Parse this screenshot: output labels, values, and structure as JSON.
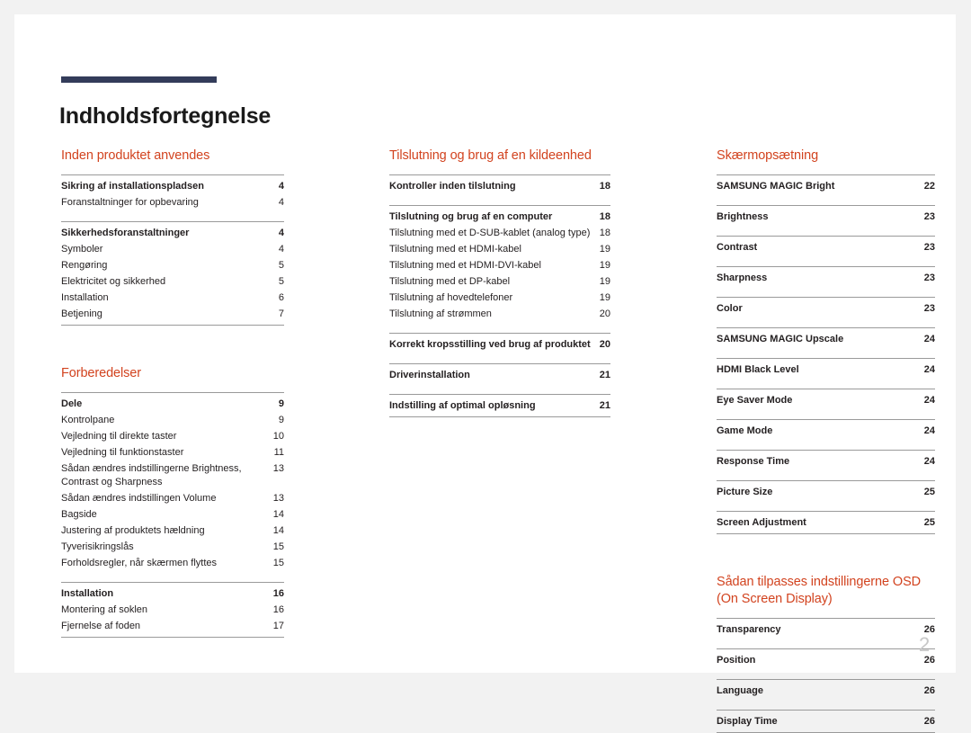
{
  "document": {
    "title": "Indholdsfortegnelse",
    "page_number": "2",
    "accent_color": "#d2431f",
    "rule_color": "#333c5a"
  },
  "columns": [
    {
      "name": "column-left",
      "sections": [
        {
          "heading": "Inden produktet anvendes",
          "blocks": [
            {
              "entries": [
                {
                  "label": "Sikring af installationspladsen",
                  "page": "4",
                  "level": "main"
                },
                {
                  "label": "Foranstaltninger for opbevaring",
                  "page": "4",
                  "level": "sub"
                }
              ]
            },
            {
              "entries": [
                {
                  "label": "Sikkerhedsforanstaltninger",
                  "page": "4",
                  "level": "main"
                },
                {
                  "label": "Symboler",
                  "page": "4",
                  "level": "sub"
                },
                {
                  "label": "Rengøring",
                  "page": "5",
                  "level": "sub"
                },
                {
                  "label": "Elektricitet og sikkerhed",
                  "page": "5",
                  "level": "sub"
                },
                {
                  "label": "Installation",
                  "page": "6",
                  "level": "sub"
                },
                {
                  "label": "Betjening",
                  "page": "7",
                  "level": "sub"
                }
              ]
            }
          ]
        },
        {
          "heading": "Forberedelser",
          "blocks": [
            {
              "entries": [
                {
                  "label": "Dele",
                  "page": "9",
                  "level": "main"
                },
                {
                  "label": "Kontrolpane",
                  "page": "9",
                  "level": "sub"
                },
                {
                  "label": "Vejledning til direkte taster",
                  "page": "10",
                  "level": "sub"
                },
                {
                  "label": "Vejledning til funktionstaster",
                  "page": "11",
                  "level": "sub"
                },
                {
                  "label": "Sådan ændres indstillingerne Brightness, Contrast og Sharpness",
                  "page": "13",
                  "level": "sub"
                },
                {
                  "label": "Sådan ændres indstillingen Volume",
                  "page": "13",
                  "level": "sub"
                },
                {
                  "label": "Bagside",
                  "page": "14",
                  "level": "sub"
                },
                {
                  "label": "Justering af produktets hældning",
                  "page": "14",
                  "level": "sub"
                },
                {
                  "label": "Tyverisikringslås",
                  "page": "15",
                  "level": "sub"
                },
                {
                  "label": "Forholdsregler, når skærmen flyttes",
                  "page": "15",
                  "level": "sub"
                }
              ]
            },
            {
              "entries": [
                {
                  "label": "Installation",
                  "page": "16",
                  "level": "main"
                },
                {
                  "label": "Montering af soklen",
                  "page": "16",
                  "level": "sub"
                },
                {
                  "label": "Fjernelse af foden",
                  "page": "17",
                  "level": "sub"
                }
              ]
            }
          ]
        }
      ]
    },
    {
      "name": "column-middle",
      "sections": [
        {
          "heading": "Tilslutning og brug af en kildeenhed",
          "blocks": [
            {
              "entries": [
                {
                  "label": "Kontroller inden tilslutning",
                  "page": "18",
                  "level": "main"
                }
              ]
            },
            {
              "entries": [
                {
                  "label": "Tilslutning og brug af en computer",
                  "page": "18",
                  "level": "main"
                },
                {
                  "label": "Tilslutning med et D-SUB-kablet (analog type)",
                  "page": "18",
                  "level": "sub"
                },
                {
                  "label": "Tilslutning med et HDMI-kabel",
                  "page": "19",
                  "level": "sub"
                },
                {
                  "label": "Tilslutning med et HDMI-DVI-kabel",
                  "page": "19",
                  "level": "sub"
                },
                {
                  "label": "Tilslutning med et DP-kabel",
                  "page": "19",
                  "level": "sub"
                },
                {
                  "label": "Tilslutning af hovedtelefoner",
                  "page": "19",
                  "level": "sub"
                },
                {
                  "label": "Tilslutning af strømmen",
                  "page": "20",
                  "level": "sub"
                }
              ]
            },
            {
              "entries": [
                {
                  "label": "Korrekt kropsstilling ved brug af produktet",
                  "page": "20",
                  "level": "main"
                }
              ]
            },
            {
              "entries": [
                {
                  "label": "Driverinstallation",
                  "page": "21",
                  "level": "main"
                }
              ]
            },
            {
              "entries": [
                {
                  "label": "Indstilling af optimal opløsning",
                  "page": "21",
                  "level": "main"
                }
              ]
            }
          ]
        }
      ]
    },
    {
      "name": "column-right",
      "sections": [
        {
          "heading": "Skærmopsætning",
          "blocks": [
            {
              "entries": [
                {
                  "label": "SAMSUNG MAGIC Bright",
                  "page": "22",
                  "level": "main"
                }
              ]
            },
            {
              "entries": [
                {
                  "label": "Brightness",
                  "page": "23",
                  "level": "main"
                }
              ]
            },
            {
              "entries": [
                {
                  "label": "Contrast",
                  "page": "23",
                  "level": "main"
                }
              ]
            },
            {
              "entries": [
                {
                  "label": "Sharpness",
                  "page": "23",
                  "level": "main"
                }
              ]
            },
            {
              "entries": [
                {
                  "label": "Color",
                  "page": "23",
                  "level": "main"
                }
              ]
            },
            {
              "entries": [
                {
                  "label": "SAMSUNG MAGIC Upscale",
                  "page": "24",
                  "level": "main"
                }
              ]
            },
            {
              "entries": [
                {
                  "label": "HDMI Black Level",
                  "page": "24",
                  "level": "main"
                }
              ]
            },
            {
              "entries": [
                {
                  "label": "Eye Saver Mode",
                  "page": "24",
                  "level": "main"
                }
              ]
            },
            {
              "entries": [
                {
                  "label": "Game Mode",
                  "page": "24",
                  "level": "main"
                }
              ]
            },
            {
              "entries": [
                {
                  "label": "Response Time",
                  "page": "24",
                  "level": "main"
                }
              ]
            },
            {
              "entries": [
                {
                  "label": "Picture Size",
                  "page": "25",
                  "level": "main"
                }
              ]
            },
            {
              "entries": [
                {
                  "label": "Screen Adjustment",
                  "page": "25",
                  "level": "main"
                }
              ]
            }
          ]
        },
        {
          "heading": "Sådan tilpasses indstillingerne OSD (On Screen Display)",
          "blocks": [
            {
              "entries": [
                {
                  "label": "Transparency",
                  "page": "26",
                  "level": "main"
                }
              ]
            },
            {
              "entries": [
                {
                  "label": "Position",
                  "page": "26",
                  "level": "main"
                }
              ]
            },
            {
              "entries": [
                {
                  "label": "Language",
                  "page": "26",
                  "level": "main"
                }
              ]
            },
            {
              "entries": [
                {
                  "label": "Display Time",
                  "page": "26",
                  "level": "main"
                }
              ]
            }
          ]
        }
      ]
    }
  ]
}
